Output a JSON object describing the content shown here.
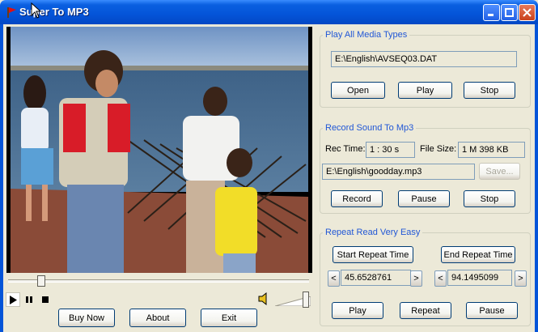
{
  "window": {
    "title": "Super To MP3"
  },
  "player": {
    "seek_value": 0.1,
    "volume_value": 0.95,
    "buttons": {
      "buy_now": "Buy Now",
      "about": "About",
      "exit": "Exit"
    }
  },
  "play_all": {
    "legend": "Play All Media Types",
    "path": "E:\\English\\AVSEQ03.DAT",
    "open": "Open",
    "play": "Play",
    "stop": "Stop"
  },
  "record": {
    "legend": "Record Sound To Mp3",
    "rec_time_label": "Rec Time:",
    "rec_time_value": "1 : 30 s",
    "file_size_label": "File Size:",
    "file_size_value": "1 M 398 KB",
    "path": "E:\\English\\goodday.mp3",
    "save": "Save...",
    "record": "Record",
    "pause": "Pause",
    "stop": "Stop"
  },
  "repeat": {
    "legend": "Repeat Read Very Easy",
    "start": "Start Repeat Time",
    "end": "End  Repeat Time",
    "start_value": "45.6528761",
    "end_value": "94.1495099",
    "dec": "<",
    "inc": ">",
    "play": "Play",
    "repeat": "Repeat",
    "pause": "Pause"
  }
}
